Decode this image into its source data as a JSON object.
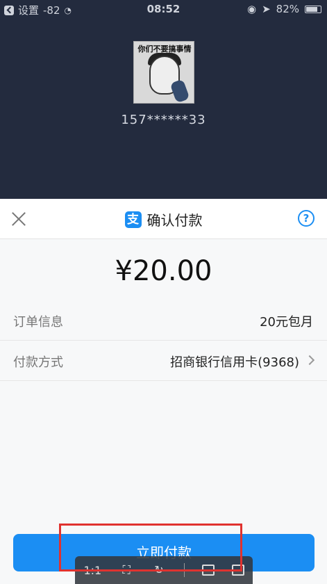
{
  "status_bar": {
    "carrier": "设置",
    "signal": "-82",
    "time": "08:52",
    "battery_percent": "82%",
    "battery_level": 0.82
  },
  "profile": {
    "avatar_caption": "你们不要搞事情",
    "account": "157******33"
  },
  "sheet": {
    "title": "确认付款",
    "logo_text": "支",
    "help": "?",
    "amount": "¥20.00",
    "rows": [
      {
        "label": "订单信息",
        "value": "20元包月"
      },
      {
        "label": "付款方式",
        "value": "招商银行信用卡(9368)"
      }
    ],
    "pay_button": "立即付款"
  },
  "toolbar": {
    "ratio": "1:1"
  },
  "colors": {
    "accent": "#1b8ef3",
    "dark_bg": "#232b3e",
    "highlight": "#e0322f"
  }
}
